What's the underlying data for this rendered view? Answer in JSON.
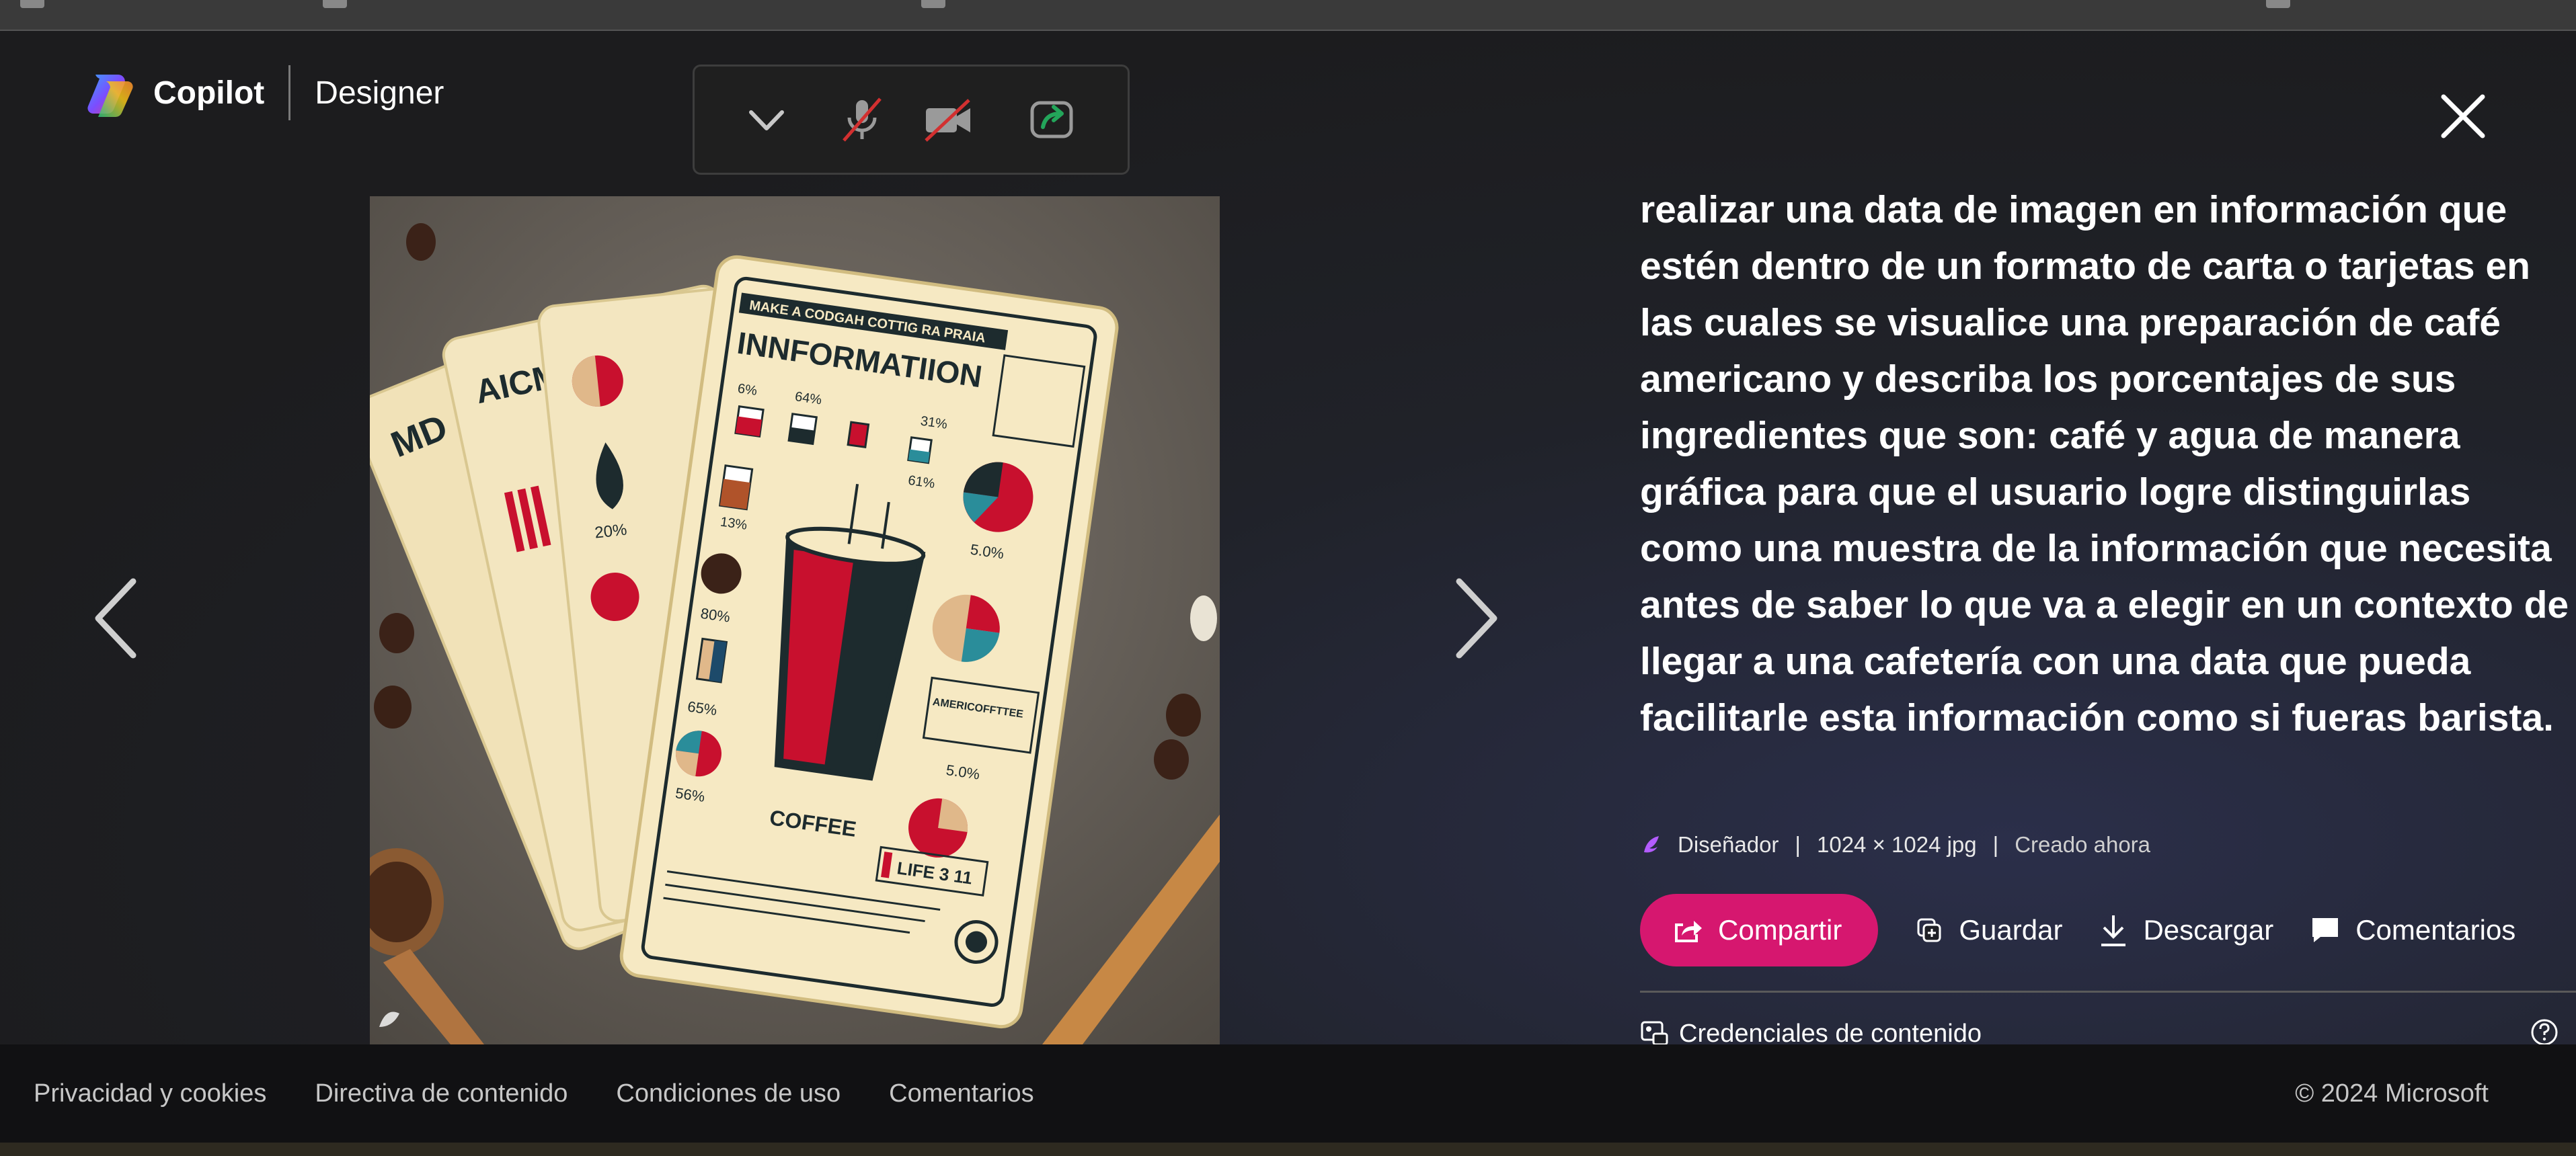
{
  "brand": {
    "name": "Copilot",
    "product": "Designer"
  },
  "prompt": "realizar una data de imagen en información que estén dentro de un formato de carta o tarjetas en las cuales se visualice una preparación de café americano y describa los porcentajes de sus ingredientes que son: café y agua de manera gráfica para que el usuario logre distinguirlas como una muestra de la información que necesita antes de saber lo que va a elegir en un contexto de llegar a una cafetería con una data que pueda facilitarle esta información como si fueras barista.",
  "meta": {
    "source": "Diseñador",
    "separator": "|",
    "dimensions": "1024 × 1024 jpg",
    "created": "Creado ahora"
  },
  "actions": {
    "share": "Compartir",
    "save": "Guardar",
    "download": "Descargar",
    "comments": "Comentarios"
  },
  "credentials": "Credenciales de contenido",
  "image": {
    "card_title": "INNFORMATIION",
    "card_header": "MAKE A CODGAH COTTIG  RA PRAIA",
    "coffee_label": "COFFEE",
    "life_label": "LIFE 3 11",
    "ameri_label": "AMERICOFFTTEE",
    "percent_1": "6%",
    "percent_2": "64%",
    "percent_3": "61%",
    "percent_4": "31%",
    "percent_5": "5.0%",
    "percent_6": "80%",
    "percent_7": "65%",
    "percent_8": "56%",
    "percent_9": "5.0%",
    "percent_10": "13%",
    "side_a": "MD",
    "side_b": "AICM",
    "side_c": "20%"
  },
  "footer": {
    "links": [
      "Privacidad y cookies",
      "Directiva de contenido",
      "Condiciones de uso",
      "Comentarios"
    ],
    "copyright": "© 2024 Microsoft"
  },
  "colors": {
    "share_accent": "#d6176f",
    "background": "#1b1b1b",
    "footer": "#111113"
  }
}
